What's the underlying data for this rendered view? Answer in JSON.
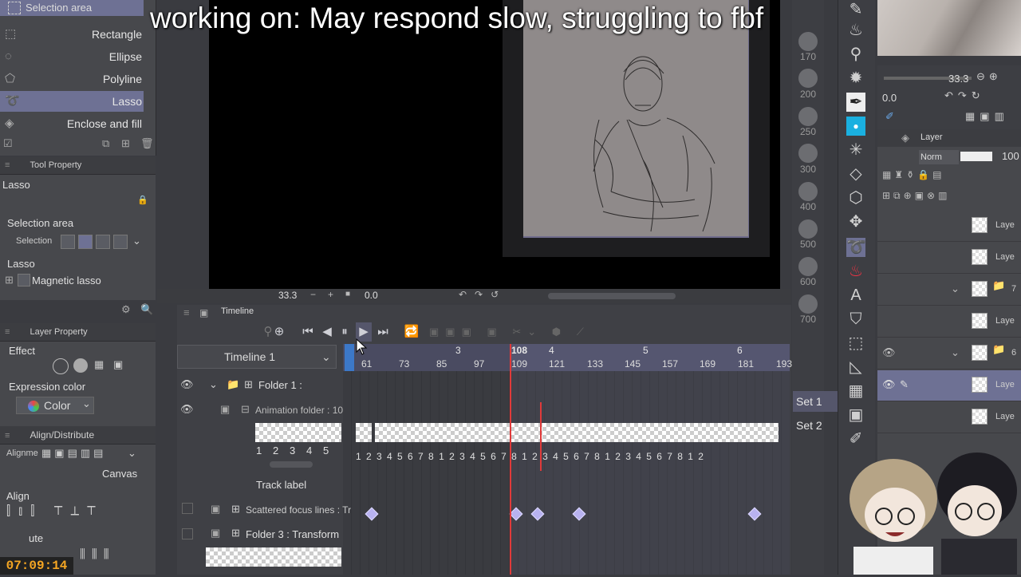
{
  "overlay": {
    "subtitle": "working on: May respond slow, struggling to fbf",
    "clock": "07:09:14"
  },
  "sub_tool": {
    "header": "Selection area",
    "items": [
      {
        "label": "Rectangle",
        "icon": "rectangle-select-icon"
      },
      {
        "label": "Ellipse",
        "icon": "ellipse-select-icon"
      },
      {
        "label": "Polyline",
        "icon": "polyline-select-icon"
      },
      {
        "label": "Lasso",
        "icon": "lasso-icon",
        "selected": true
      },
      {
        "label": "Enclose and fill",
        "icon": "enclose-fill-icon"
      }
    ]
  },
  "tool_property": {
    "title": "Tool Property",
    "tool_name": "Lasso",
    "selection_area_label": "Selection area",
    "selection_sub": "Selection",
    "lasso_label": "Lasso",
    "magnetic_lasso": "Magnetic lasso"
  },
  "layer_property": {
    "title": "Layer Property",
    "effect_label": "Effect",
    "expression_color_label": "Expression color",
    "color_value": "Color"
  },
  "align": {
    "title": "Align/Distribute",
    "alignment_label": "Alignme",
    "canvas_option": "Canvas",
    "align_label": "Align",
    "distribute_label": "ute"
  },
  "canvas_status": {
    "zoom": "33.3",
    "angle": "0.0"
  },
  "brush_sizes": [
    "170",
    "200",
    "250",
    "300",
    "400",
    "500",
    "600",
    "700"
  ],
  "navigator": {
    "zoom": "33.3",
    "angle": "0.0",
    "opacity": "100"
  },
  "layer_panel": {
    "title": "Layer",
    "blend_mode": "Norm",
    "rows": [
      {
        "name": "Laye"
      },
      {
        "name": "Laye"
      },
      {
        "name": "7"
      },
      {
        "name": "Laye"
      },
      {
        "name": "6"
      },
      {
        "name": "Laye",
        "selected": true
      },
      {
        "name": "Laye"
      }
    ]
  },
  "timeline": {
    "tab_title": "Timeline",
    "name": "Timeline 1",
    "ruler_seconds": [
      {
        "label": "3"
      },
      {
        "label": "4"
      },
      {
        "label": "5"
      },
      {
        "label": "6"
      }
    ],
    "ruler_frames": [
      "61",
      "73",
      "85",
      "97",
      "109",
      "121",
      "133",
      "145",
      "157",
      "169",
      "181",
      "193"
    ],
    "current_frame": "108",
    "tracks": {
      "folder1": "Folder 1 :",
      "animation_folder": "Animation folder : 10",
      "cel_numbers": [
        "1",
        "2",
        "3",
        "4",
        "5"
      ],
      "frame_sequence": "1 2 3 4 5 6 7 8 1 2 3 4 5 6 7 8 1 2 3 4 5 6 7 8 1 2 3 4 5 6 7 8 1 2",
      "track_label": "Track label",
      "scattered": "Scattered focus lines : Tr",
      "folder3": "Folder 3 : Transform"
    },
    "sets": [
      "Set 1",
      "Set 2"
    ]
  }
}
